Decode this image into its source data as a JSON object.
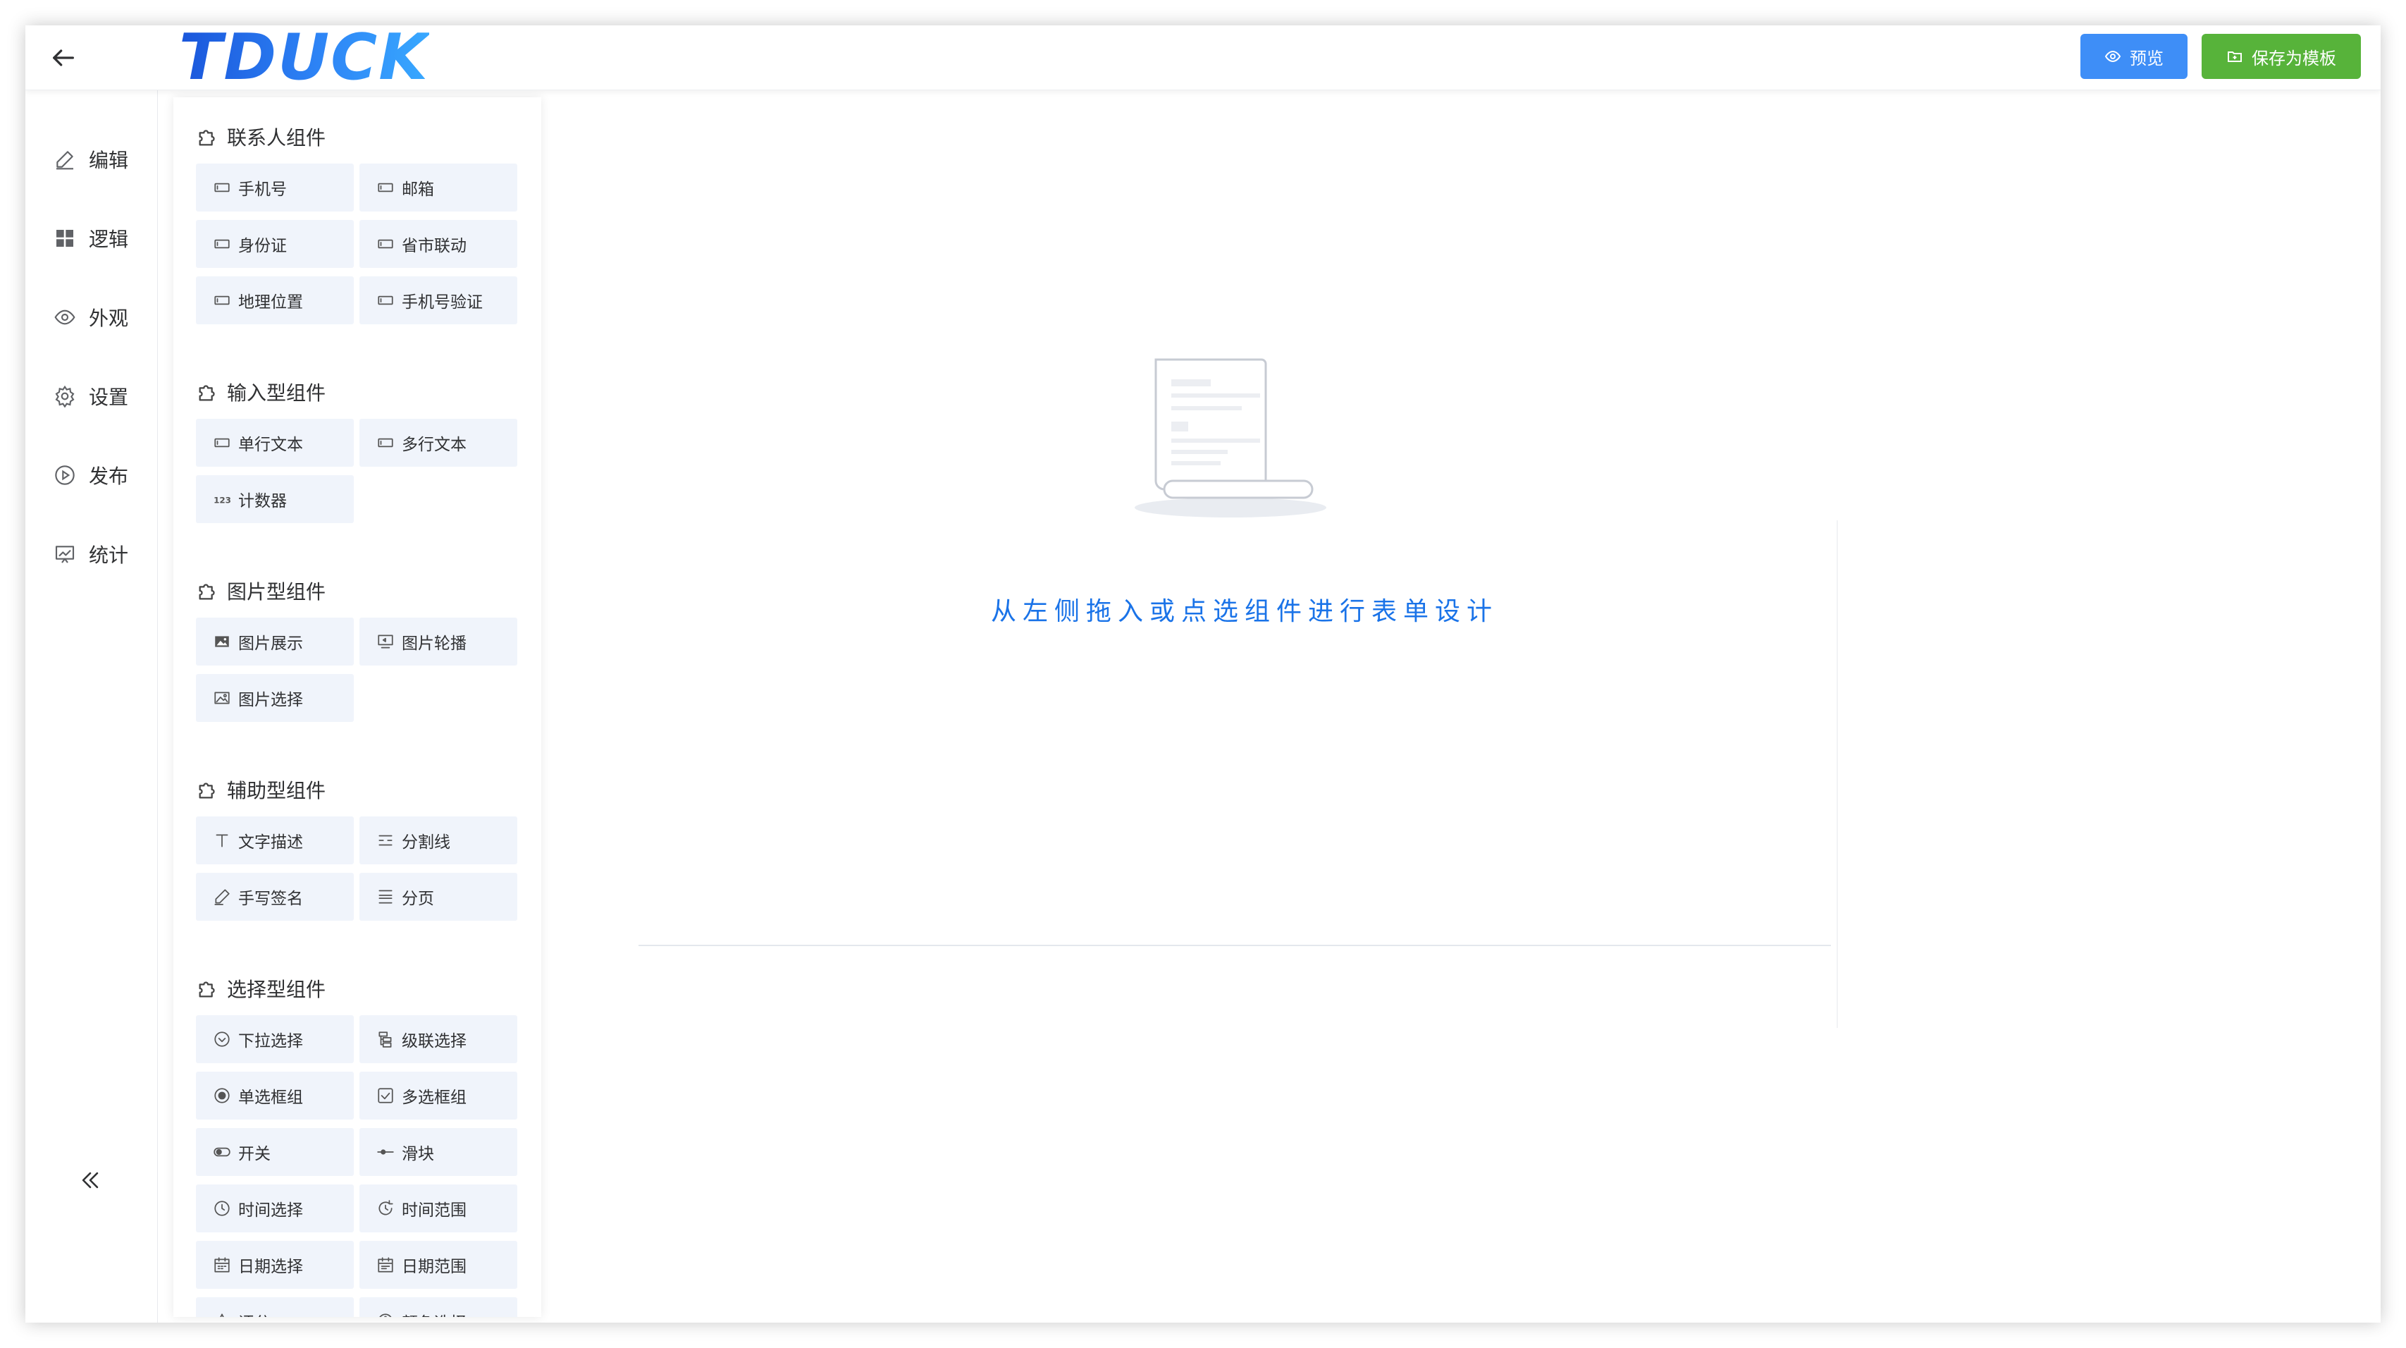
{
  "header": {
    "logo_text": "TDUCK",
    "preview_label": "预览",
    "save_template_label": "保存为模板",
    "colors": {
      "primary": "#3e8ef7",
      "success": "#57b33a"
    }
  },
  "nav": {
    "items": [
      {
        "label": "编辑",
        "icon": "edit-icon"
      },
      {
        "label": "逻辑",
        "icon": "grid-icon"
      },
      {
        "label": "外观",
        "icon": "eye-icon"
      },
      {
        "label": "设置",
        "icon": "gear-icon"
      },
      {
        "label": "发布",
        "icon": "play-icon"
      },
      {
        "label": "统计",
        "icon": "chart-icon"
      }
    ]
  },
  "groups": [
    {
      "title": "联系人组件",
      "items": [
        {
          "label": "手机号",
          "icon": "input-icon"
        },
        {
          "label": "邮箱",
          "icon": "input-icon"
        },
        {
          "label": "身份证",
          "icon": "input-icon"
        },
        {
          "label": "省市联动",
          "icon": "input-icon"
        },
        {
          "label": "地理位置",
          "icon": "input-icon"
        },
        {
          "label": "手机号验证",
          "icon": "input-icon"
        }
      ]
    },
    {
      "title": "输入型组件",
      "items": [
        {
          "label": "单行文本",
          "icon": "input-icon"
        },
        {
          "label": "多行文本",
          "icon": "input-icon"
        },
        {
          "label": "计数器",
          "icon": "number-icon"
        }
      ]
    },
    {
      "title": "图片型组件",
      "items": [
        {
          "label": "图片展示",
          "icon": "image-icon"
        },
        {
          "label": "图片轮播",
          "icon": "carousel-icon"
        },
        {
          "label": "图片选择",
          "icon": "image-select-icon"
        }
      ]
    },
    {
      "title": "辅助型组件",
      "items": [
        {
          "label": "文字描述",
          "icon": "text-icon"
        },
        {
          "label": "分割线",
          "icon": "divider-icon"
        },
        {
          "label": "手写签名",
          "icon": "pen-icon"
        },
        {
          "label": "分页",
          "icon": "pagination-icon"
        }
      ]
    },
    {
      "title": "选择型组件",
      "items": [
        {
          "label": "下拉选择",
          "icon": "select-icon"
        },
        {
          "label": "级联选择",
          "icon": "cascader-icon"
        },
        {
          "label": "单选框组",
          "icon": "radio-icon"
        },
        {
          "label": "多选框组",
          "icon": "checkbox-icon"
        },
        {
          "label": "开关",
          "icon": "switch-icon"
        },
        {
          "label": "滑块",
          "icon": "slider-icon"
        },
        {
          "label": "时间选择",
          "icon": "clock-icon"
        },
        {
          "label": "时间范围",
          "icon": "clock-range-icon"
        },
        {
          "label": "日期选择",
          "icon": "calendar-icon"
        },
        {
          "label": "日期范围",
          "icon": "calendar-range-icon"
        },
        {
          "label": "评分",
          "icon": "star-icon"
        },
        {
          "label": "颜色选择",
          "icon": "palette-icon"
        }
      ]
    }
  ],
  "canvas": {
    "empty_text": "从左侧拖入或点选组件进行表单设计"
  }
}
